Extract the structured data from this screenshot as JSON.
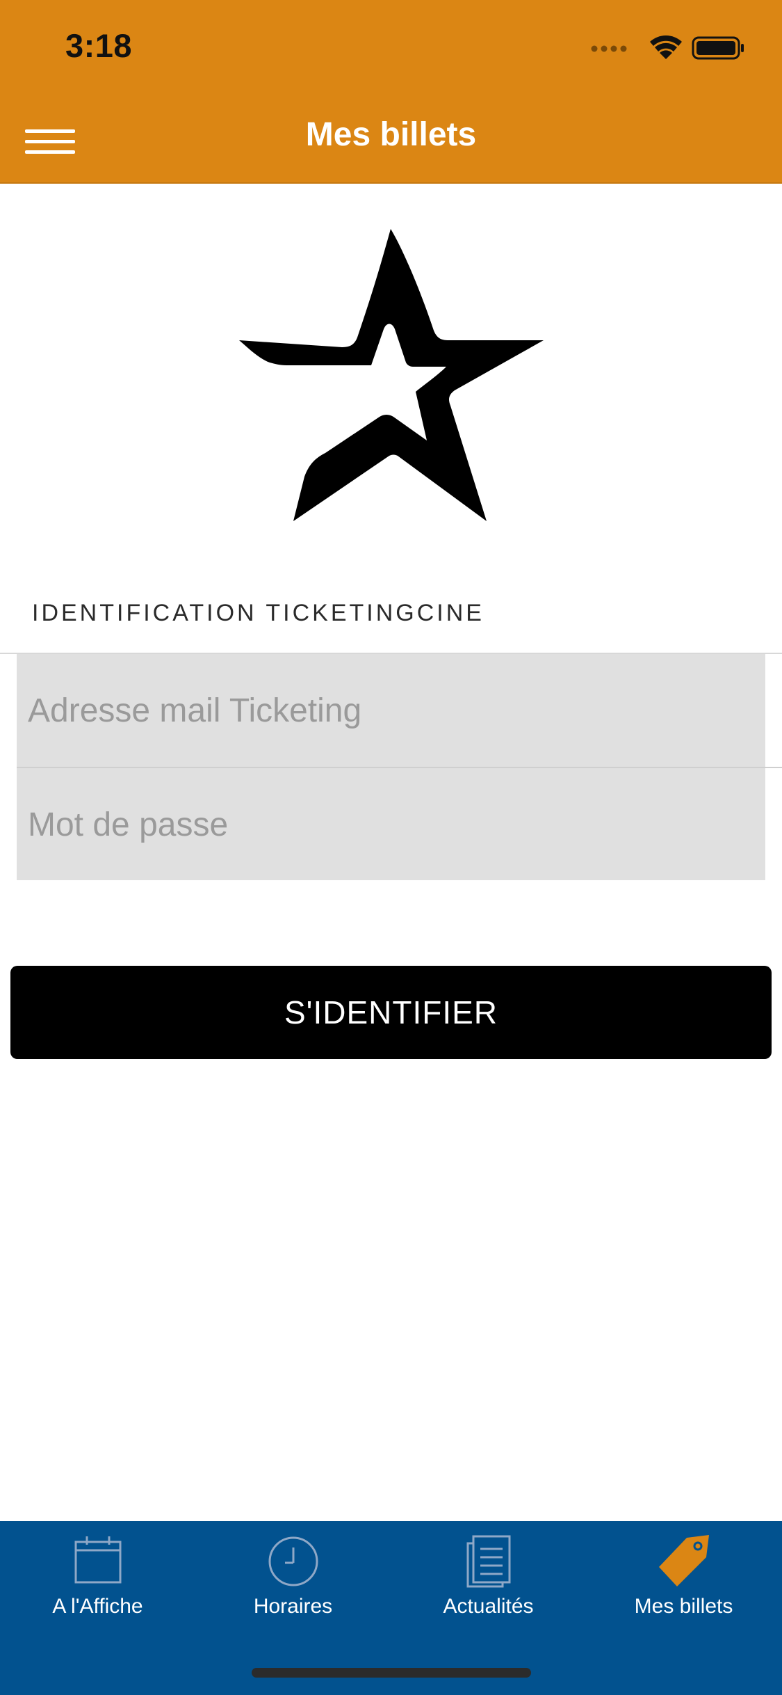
{
  "status_bar": {
    "time": "3:18"
  },
  "header": {
    "title": "Mes billets",
    "background_color": "#DB8614",
    "menu_icon": "hamburger-menu-icon"
  },
  "logo": {
    "icon": "star-logo-icon"
  },
  "login": {
    "section_label": "IDENTIFICATION TICKETINGCINE",
    "email_placeholder": "Adresse mail Ticketing",
    "email_value": "",
    "password_placeholder": "Mot de passe",
    "password_value": "",
    "submit_label": "S'IDENTIFIER"
  },
  "tabbar": {
    "background_color": "#02528F",
    "active_color": "#DB8614",
    "items": [
      {
        "label": "A l'Affiche",
        "icon": "calendar-icon",
        "active": false
      },
      {
        "label": "Horaires",
        "icon": "clock-icon",
        "active": false
      },
      {
        "label": "Actualités",
        "icon": "news-document-icon",
        "active": false
      },
      {
        "label": "Mes billets",
        "icon": "ticket-tag-icon",
        "active": true
      }
    ]
  }
}
